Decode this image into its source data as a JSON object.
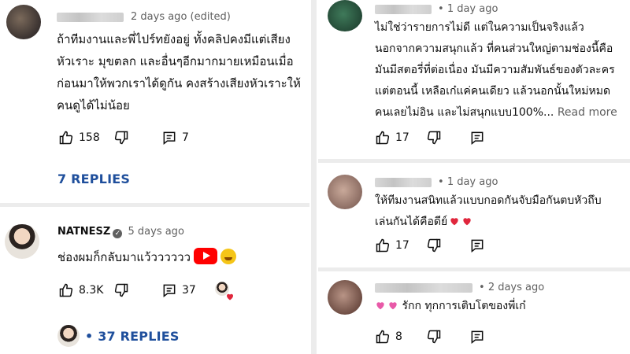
{
  "left": {
    "comment1": {
      "time": "2 days ago (edited)",
      "lines": [
        "ถ้าทีมงานและพี่ไปร์ทยังอยู่ ทั้งคลิปคงมีแต่เสียง",
        "หัวเราะ มุขตลก และอื่นๆอีกมากมายเหมือนเมื่อ",
        "ก่อนมาให้พวกเราได้ดูกัน คงสร้างเสียงหัวเราะให้",
        "คนดูได้ไม่น้อย"
      ],
      "likes": "158",
      "replies_count": "7",
      "replies_label": "7 REPLIES"
    },
    "comment2": {
      "author": "NATNESZ",
      "time": "5 days ago",
      "text": "ช่องผมก็กลับมาแว้วววววว",
      "likes": "8.3K",
      "replies_count": "37",
      "replies_label": "37 REPLIES"
    }
  },
  "right": {
    "comment1": {
      "time": "1 day ago",
      "lines": [
        "ไม่ใช่ว่ารายการไม่ดี แต่ในความเป็นจริงแล้ว",
        "นอกจากความสนุกแล้ว ที่คนส่วนใหญ่ตามช่องนี้คือ",
        "มันมีสตอรี่ที่ต่อเนื่อง มันมีความสัมพันธ์ของตัวละคร",
        "แต่ตอนนี้ เหลือเก๋แค่คนเดียว แล้วนอกนั้นใหม่หมด",
        "คนเลยไม่อิน และไม่สนุกแบบ100%..."
      ],
      "read_more": "Read more",
      "likes": "17"
    },
    "comment2": {
      "time": "1 day ago",
      "lines": [
        "ให้ทีมงานสนิทแล้วแบบกอดกันจับมือกันตบหัวถึบ",
        "เล่นกันได้คือดีย์"
      ],
      "likes": "17"
    },
    "comment3": {
      "time": "2 days ago",
      "text": "รักก ทุกการเติบโตของพี่เก๋",
      "likes": "8"
    }
  },
  "colors": {
    "replies_link": "#1f4f9c",
    "youtube_red": "#ff0000",
    "heart_red": "#e0263c",
    "muted_text": "#606060"
  }
}
